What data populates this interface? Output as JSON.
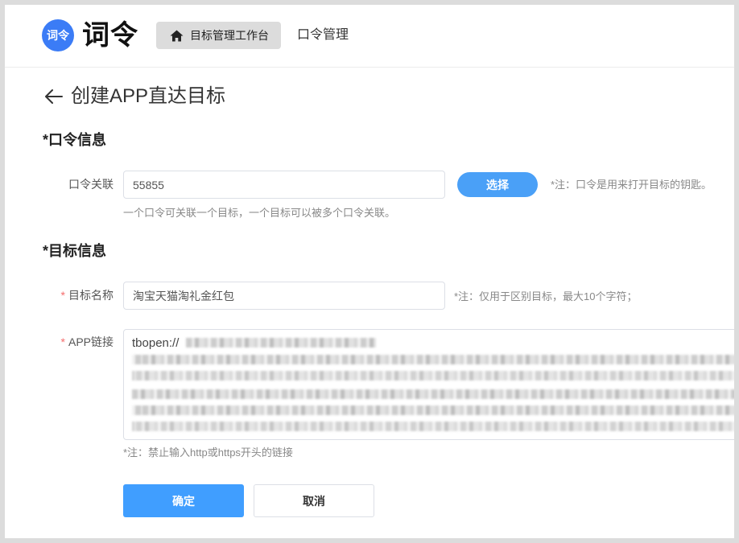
{
  "colors": {
    "brand": "#3b7cf6",
    "primary": "#409eff",
    "required": "#f56c6c",
    "nav_active_bg": "#dcdcdc"
  },
  "header": {
    "logo_badge": "词令",
    "logo_text": "词令",
    "nav": [
      {
        "label": "目标管理工作台",
        "icon": "home-icon",
        "active": true
      },
      {
        "label": "口令管理",
        "active": false
      }
    ]
  },
  "page": {
    "back_icon": "arrow-left-icon",
    "title": "创建APP直达目标"
  },
  "password_section": {
    "heading": "*口令信息",
    "field": {
      "label": "口令关联",
      "value": "55855",
      "select_label": "选择",
      "note": "*注：口令是用来打开目标的钥匙。",
      "help": "一个口令可关联一个目标，一个目标可以被多个口令关联。"
    }
  },
  "target_section": {
    "heading": "*目标信息",
    "name_field": {
      "required_mark": "*",
      "label": "目标名称",
      "value": "淘宝天猫淘礼金红包",
      "note": "*注：仅用于区别目标，最大10个字符；"
    },
    "link_field": {
      "required_mark": "*",
      "label": "APP链接",
      "value_visible": "tbopen://",
      "help": "*注：禁止输入http或https开头的链接"
    }
  },
  "actions": {
    "confirm": "确定",
    "cancel": "取消"
  }
}
